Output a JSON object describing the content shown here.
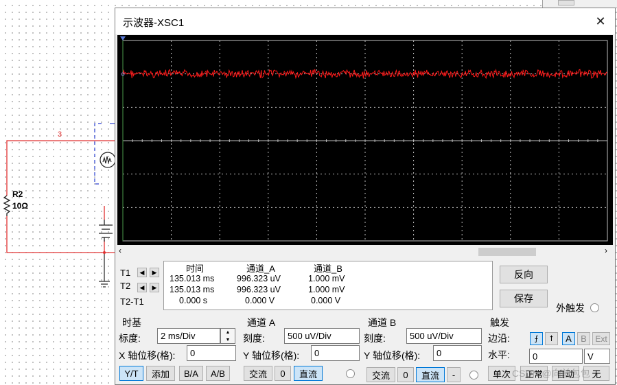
{
  "window": {
    "title": "示波器-XSC1",
    "close_glyph": "✕"
  },
  "schematic": {
    "node_label": "3",
    "resistor_name": "R2",
    "resistor_value": "10Ω"
  },
  "readout": {
    "headers": [
      "时间",
      "通道_A",
      "通道_B"
    ],
    "rows": [
      {
        "label": "T1",
        "time": "135.013 ms",
        "a": "996.323 uV",
        "b": "1.000 mV"
      },
      {
        "label": "T2",
        "time": "135.013 ms",
        "a": "996.323 uV",
        "b": "1.000 mV"
      },
      {
        "label": "T2-T1",
        "time": "0.000 s",
        "a": "0.000 V",
        "b": "0.000 V"
      }
    ]
  },
  "buttons": {
    "reverse": "反向",
    "save": "保存",
    "external_trigger": "外触发"
  },
  "timebase": {
    "title": "时基",
    "scale_label": "标度:",
    "scale_value": "2 ms/Div",
    "xpos_label": "X 轴位移(格):",
    "xpos_value": "0",
    "modes": [
      "Y/T",
      "添加",
      "B/A",
      "A/B"
    ]
  },
  "channel_a": {
    "title": "通道 A",
    "scale_label": "刻度:",
    "scale_value": "500 uV/Div",
    "ypos_label": "Y 轴位移(格):",
    "ypos_value": "0",
    "coupling": [
      "交流",
      "0",
      "直流"
    ]
  },
  "channel_b": {
    "title": "通道 B",
    "scale_label": "刻度:",
    "scale_value": "500 uV/Div",
    "ypos_label": "Y 轴位移(格):",
    "ypos_value": "0",
    "coupling": [
      "交流",
      "0",
      "直流",
      "-"
    ]
  },
  "trigger": {
    "title": "触发",
    "edge_label": "边沿:",
    "source": [
      "A",
      "B",
      "Ext"
    ],
    "level_label": "水平:",
    "level_value": "0",
    "level_unit": "V",
    "modes": [
      "单次",
      "正常",
      "自动",
      "无"
    ]
  },
  "watermark": "CSDN @向前包包",
  "colors": {
    "trace": "#ff1a1a",
    "grid": "#bfbfbf",
    "screen": "#000000",
    "wire": "#e03030",
    "schematic_blue": "#2a3fd0"
  },
  "trace_level_divisions": 2.0,
  "screen_divisions": {
    "x": 10,
    "y": 6
  }
}
